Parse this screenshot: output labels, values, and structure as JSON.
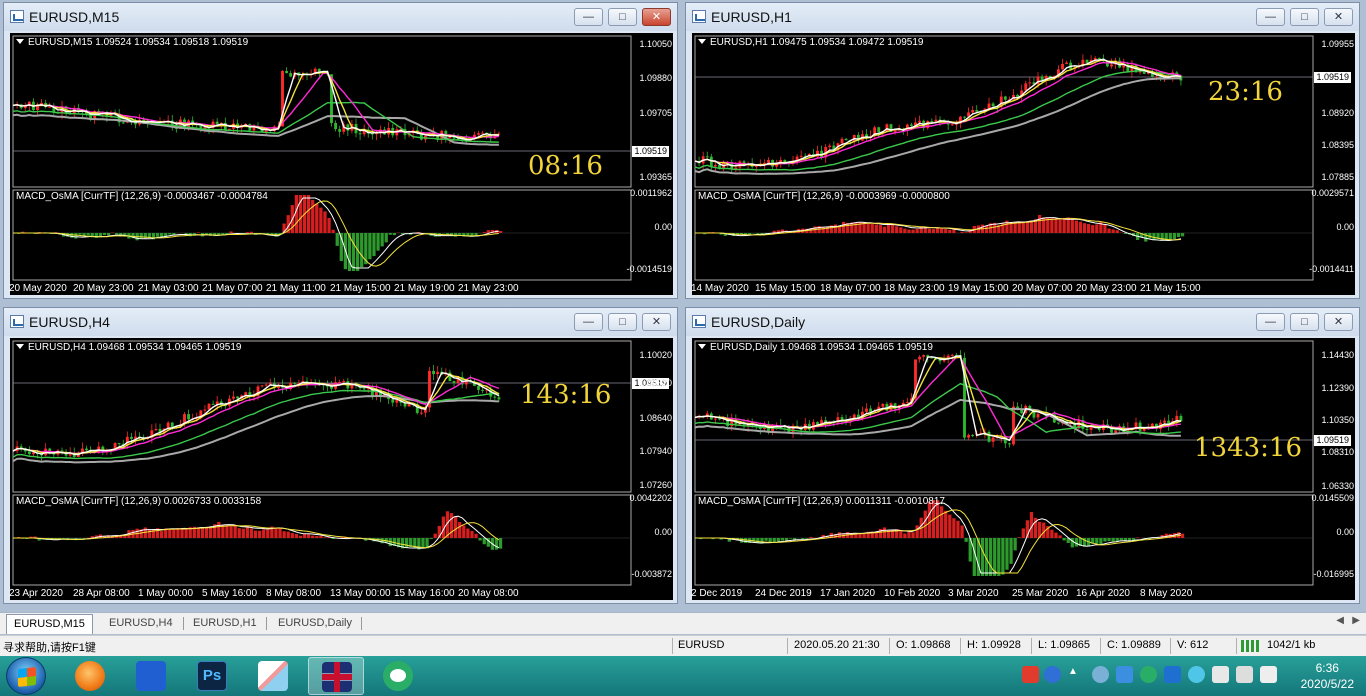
{
  "windows": [
    {
      "title": "EURUSD,M15",
      "header": "EURUSD,M15  1.09524 1.09534 1.09518 1.09519",
      "macd_header": "MACD_OsMA [CurrTF] (12,26,9) -0.0003467 -0.0004784",
      "timer": "08:16",
      "price_tag": "1.09519",
      "price_axis": [
        "1.10050",
        "1.09880",
        "1.09705",
        "1.09365"
      ],
      "macd_axis": [
        "0.0011962",
        "0.00",
        "-0.0014519"
      ],
      "time_axis": [
        "20 May 2020",
        "20 May 23:00",
        "21 May 03:00",
        "21 May 07:00",
        "21 May 11:00",
        "21 May 15:00",
        "21 May 19:00",
        "21 May 23:00"
      ],
      "close_active": true
    },
    {
      "title": "EURUSD,H1",
      "header": "EURUSD,H1  1.09475 1.09534 1.09472 1.09519",
      "macd_header": "MACD_OsMA [CurrTF] (12,26,9) -0.0003969 -0.0000800",
      "timer": "23:16",
      "price_tag": "1.09519",
      "price_axis": [
        "1.09955",
        "1.08920",
        "1.08395",
        "1.07885"
      ],
      "macd_axis": [
        "0.0029571",
        "0.00",
        "-0.0014411"
      ],
      "time_axis": [
        "14 May 2020",
        "15 May 15:00",
        "18 May 07:00",
        "18 May 23:00",
        "19 May 15:00",
        "20 May 07:00",
        "20 May 23:00",
        "21 May 15:00"
      ],
      "close_active": false
    },
    {
      "title": "EURUSD,H4",
      "header": "EURUSD,H4  1.09468 1.09534 1.09465 1.09519",
      "macd_header": "MACD_OsMA [CurrTF] (12,26,9) 0.0026733 0.0033158",
      "timer": "143:16",
      "price_tag": "1.09519",
      "price_axis": [
        "1.10020",
        "1.09320",
        "1.08640",
        "1.07940",
        "1.07260"
      ],
      "macd_axis": [
        "0.0042202",
        "0.00",
        "-0.003872"
      ],
      "time_axis": [
        "23 Apr 2020",
        "28 Apr 08:00",
        "1 May 00:00",
        "5 May 16:00",
        "8 May 08:00",
        "13 May 00:00",
        "15 May 16:00",
        "20 May 08:00"
      ],
      "close_active": false
    },
    {
      "title": "EURUSD,Daily",
      "header": "EURUSD,Daily  1.09468 1.09534 1.09465 1.09519",
      "macd_header": "MACD_OsMA [CurrTF] (12,26,9) 0.0011311 -0.0010817",
      "timer": "1343:16",
      "price_tag": "1.09519",
      "price_axis": [
        "1.14430",
        "1.12390",
        "1.10350",
        "1.08310",
        "1.06330"
      ],
      "macd_axis": [
        "0.0145509",
        "0.00",
        "-0.016995"
      ],
      "time_axis": [
        "2 Dec 2019",
        "24 Dec 2019",
        "17 Jan 2020",
        "10 Feb 2020",
        "3 Mar 2020",
        "25 Mar 2020",
        "16 Apr 2020",
        "8 May 2020"
      ],
      "close_active": false
    }
  ],
  "tabs": [
    "EURUSD,M15",
    "EURUSD,H4",
    "EURUSD,H1",
    "EURUSD,Daily"
  ],
  "status": {
    "help": "寻求帮助,请按F1键",
    "symbol": "EURUSD",
    "datetime": "2020.05.20 21:30",
    "open": "O: 1.09868",
    "high": "H: 1.09928",
    "low": "L: 1.09865",
    "close": "C: 1.09889",
    "volume": "V: 612",
    "traffic": "1042/1 kb"
  },
  "clock": {
    "time": "6:36",
    "date": "2020/5/22"
  },
  "colors": {
    "chart_bg": "#000000",
    "bull": "#ff2a2a",
    "bear": "#2eb82e",
    "ma_fast": "#ffffff",
    "ma_yellow": "#f5e23b",
    "ma_magenta": "#ff2bd6",
    "ma_green": "#3bc84a",
    "ma_gray": "#a8a8a8",
    "timer": "#f1d43a"
  }
}
